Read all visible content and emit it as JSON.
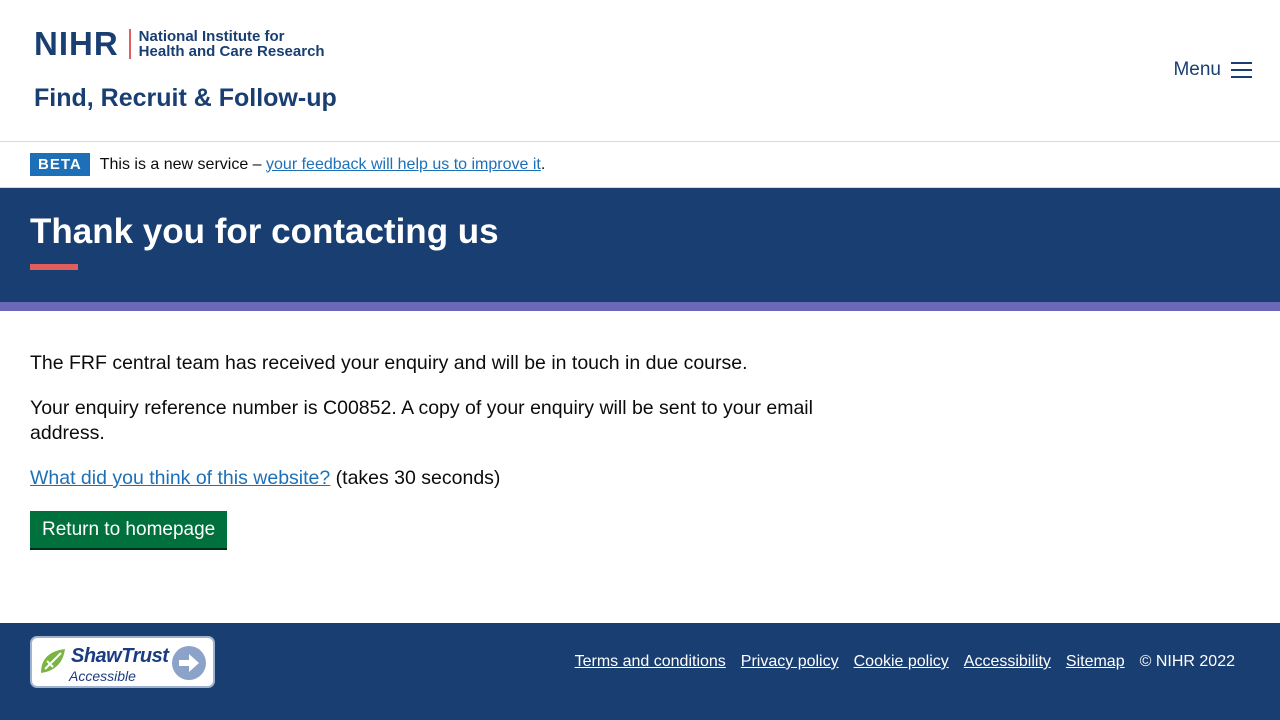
{
  "header": {
    "logo": {
      "wordmark": "NIHR",
      "name_line1": "National Institute for",
      "name_line2": "Health and Care Research"
    },
    "service_name": "Find, Recruit & Follow-up",
    "menu_label": "Menu"
  },
  "phase_banner": {
    "tag": "BETA",
    "text": "This is a new service – ",
    "link_text": "your feedback will help us to improve it",
    "suffix": "."
  },
  "hero": {
    "title": "Thank you for contacting us"
  },
  "main": {
    "para1": "The FRF central team has received your enquiry and will be in touch in due course.",
    "para2": "Your enquiry reference number is C00852. A copy of your enquiry will be sent to your email address.",
    "survey_link": "What did you think of this website?",
    "survey_suffix": " (takes 30 seconds)",
    "return_button": "Return to homepage"
  },
  "footer": {
    "badge": {
      "title": "ShawTrust",
      "subtitle": "Accessible"
    },
    "links": [
      "Terms and conditions",
      "Privacy policy",
      "Cookie policy",
      "Accessibility",
      "Sitemap"
    ],
    "copyright": "© NIHR 2022"
  },
  "colors": {
    "brand_navy": "#193e72",
    "accent_red": "#e05e5e",
    "stripe_purple": "#6b68b8",
    "button_green": "#00703c",
    "link_blue": "#1d70b8"
  }
}
